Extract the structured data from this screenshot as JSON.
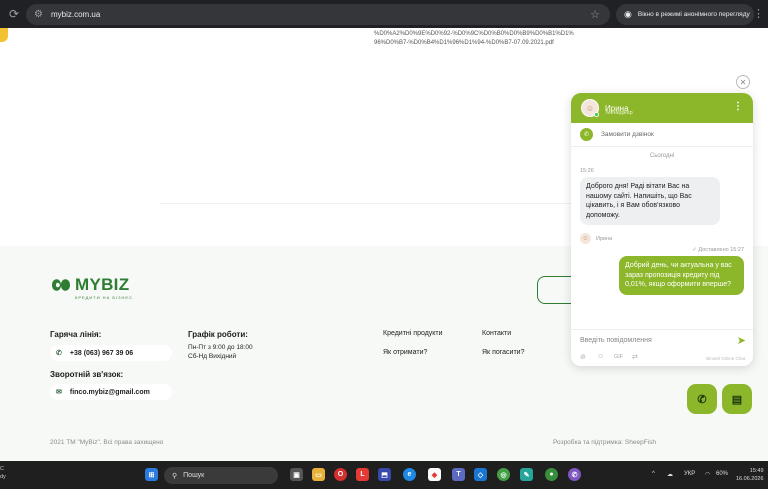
{
  "browser": {
    "url": "mybiz.com.ua",
    "incognito_label": "Вікно в режимі анонімного перегляду"
  },
  "page": {
    "pdf_link": "%D0%A2%D0%9E%D0%92-%D0%9C%D0%B0%D0%B9%D0%B1%D1%96%D0%B7-%D0%B4%D1%96%D1%94-%D0%B7-07.09.2021.pdf"
  },
  "footer": {
    "logo_text": "MYBIZ",
    "logo_subtext": "КРЕДИТИ НА БІЗНЕС",
    "hotline_title": "Гаряча лінія:",
    "hotline_phone": "+38 (063) 967 39 06",
    "feedback_title": "Зворотній зв'язок:",
    "email": "finco.mybiz@gmail.com",
    "schedule_title": "Графік роботи:",
    "schedule_weekdays": "Пн-Пт з 9:00 до 18:00",
    "schedule_weekend": "Сб-Нд Вихідний",
    "links": {
      "credit_products": "Кредитні продукти",
      "contacts": "Контакти",
      "how_to_get": "Як отримати?",
      "how_to_repay": "Як погасити?"
    },
    "copyright": "2021 ТМ \"MyBiz\". Всі права захищено",
    "developer": "Розробка та підтримка: SheepFish"
  },
  "chat": {
    "agent_name": "Ирина",
    "agent_role": "Менеджер",
    "callback_label": "Замовити дзвінок",
    "today_label": "Сьогодні",
    "time_first": "15:26",
    "message_in": "Доброго дня! Раді вітати Вас на нашому сайті. Напишіть, що Вас цікавить, і я Вам обов'язково допоможу.",
    "author_label": "Ирина",
    "delivered_label": "✓ Доставлено 15:27",
    "message_out": "Добрий день, чи актуальна у вас зараз пропозиція кредиту під 0,01%, якщо оформити вперше?",
    "input_placeholder": "Введіть повідомлення",
    "gif_label": "GIF",
    "powered_by": "Binotel Online Chat"
  },
  "taskbar": {
    "left_text_1": "C",
    "left_text_2": "dy",
    "search_label": "Пошук",
    "language": "УКР",
    "battery": "60%",
    "time": "15:49",
    "date": "16.06.2026"
  },
  "colors": {
    "brand_green": "#8db72a",
    "logo_green": "#2e7d32",
    "browser_dark": "#202124"
  }
}
